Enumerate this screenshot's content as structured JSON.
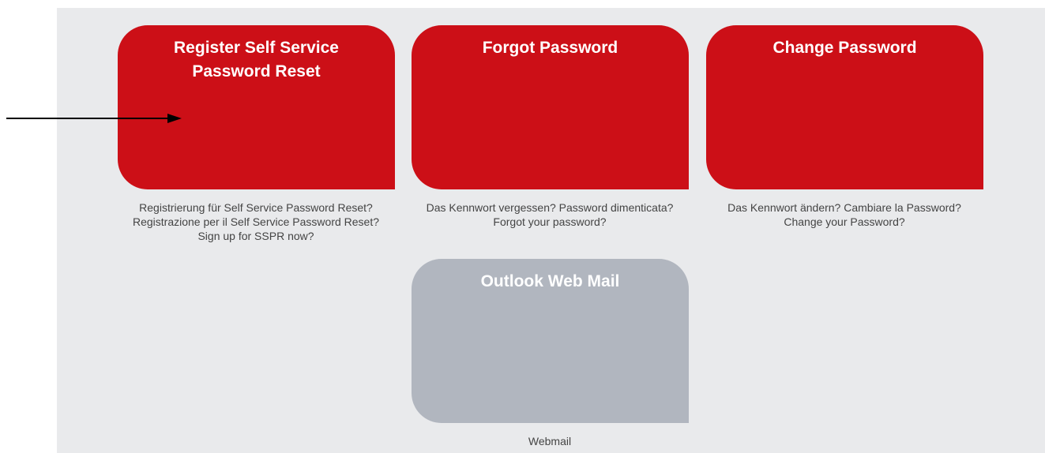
{
  "tiles": [
    {
      "title": "Register Self Service Password Reset",
      "color": "#cc0f17",
      "caption": [
        "Registrierung für Self Service Password Reset?",
        "Registrazione per il Self Service Password Reset?",
        "Sign up for SSPR now?"
      ]
    },
    {
      "title": "Forgot Password",
      "color": "#cc0f17",
      "caption": [
        "Das Kennwort vergessen? Password dimenticata?",
        "Forgot your password?"
      ]
    },
    {
      "title": "Change Password",
      "color": "#cc0f17",
      "caption": [
        "Das Kennwort ändern? Cambiare la Password?",
        "Change your Password?"
      ]
    },
    {
      "title": "Outlook Web Mail",
      "color": "#b1b6bf",
      "caption": [
        "Webmail"
      ]
    }
  ],
  "annotation": {
    "icon": "arrow-right-icon",
    "color": "#000000"
  }
}
